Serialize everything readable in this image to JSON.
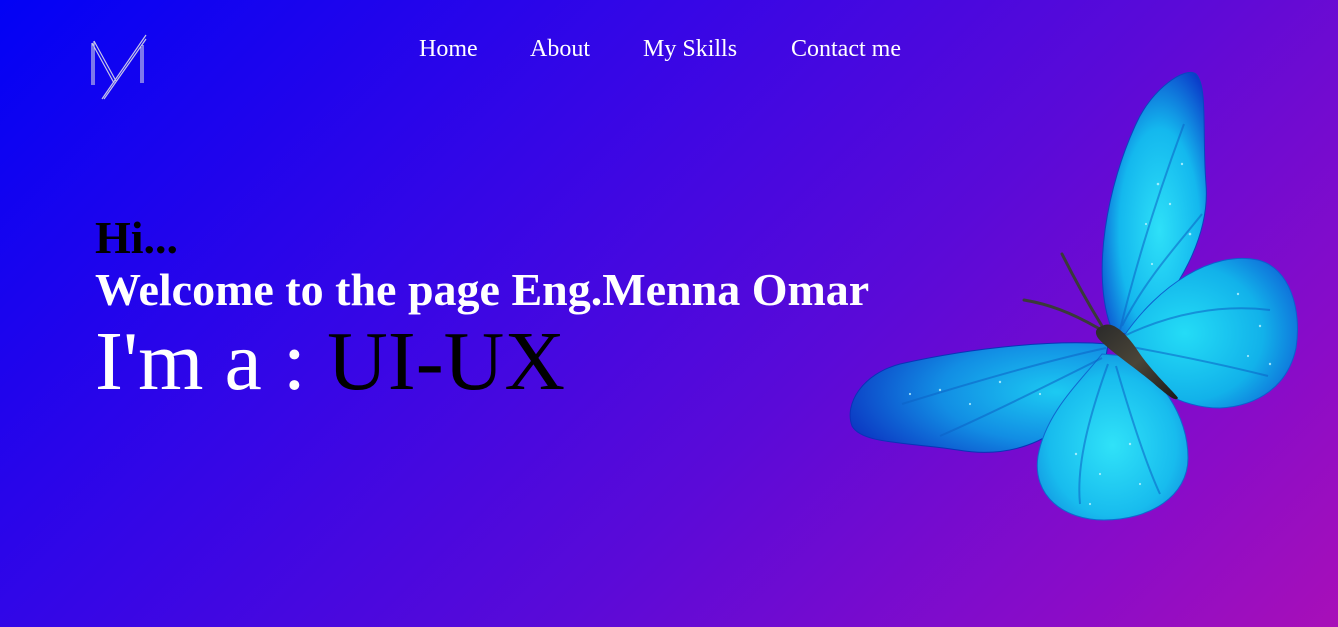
{
  "logo": {
    "icon": "monogram-m-logo-icon"
  },
  "nav": {
    "items": [
      {
        "label": "Home"
      },
      {
        "label": "About"
      },
      {
        "label": "My Skills"
      },
      {
        "label": "Contact me"
      }
    ]
  },
  "hero": {
    "greeting": "Hi...",
    "welcome": "Welcome to the page Eng.Menna Omar",
    "role_prefix": "I'm a : ",
    "role_value": "UI-UX"
  },
  "illustration": {
    "icon": "butterfly-icon",
    "wing_color": "#1fc8f0",
    "wing_dark_color": "#0a35c8"
  },
  "colors": {
    "gradient_start": "#0202f5",
    "gradient_end": "#a80fb8",
    "nav_text": "#ffffff"
  }
}
